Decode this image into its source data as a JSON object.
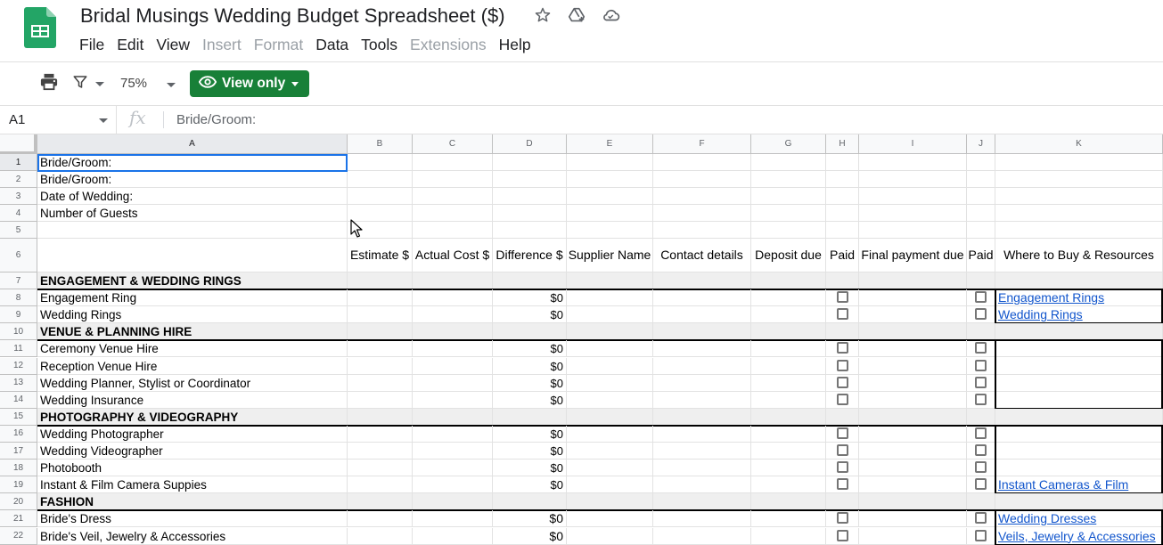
{
  "app": {
    "title": "Bridal Musings Wedding Budget Spreadsheet ($)",
    "title_icons": [
      "star-icon",
      "move-to-drive-icon",
      "cloud-saved-icon"
    ],
    "brand_color": "#188038"
  },
  "menu": [
    {
      "label": "File",
      "disabled": false
    },
    {
      "label": "Edit",
      "disabled": false
    },
    {
      "label": "View",
      "disabled": false
    },
    {
      "label": "Insert",
      "disabled": true
    },
    {
      "label": "Format",
      "disabled": true
    },
    {
      "label": "Data",
      "disabled": false
    },
    {
      "label": "Tools",
      "disabled": false
    },
    {
      "label": "Extensions",
      "disabled": true
    },
    {
      "label": "Help",
      "disabled": false
    }
  ],
  "toolbar": {
    "zoom": "75%",
    "view_only_label": "View only"
  },
  "formula_bar": {
    "cell_ref": "A1",
    "fx_label": "fx",
    "value": "Bride/Groom:"
  },
  "columns": [
    "A",
    "B",
    "C",
    "D",
    "E",
    "F",
    "G",
    "H",
    "I",
    "J",
    "K"
  ],
  "selected_cell": "A1",
  "info_rows": [
    {
      "row": 1,
      "label": "Bride/Groom:"
    },
    {
      "row": 2,
      "label": "Bride/Groom:"
    },
    {
      "row": 3,
      "label": "Date of Wedding:"
    },
    {
      "row": 4,
      "label": "Number of Guests"
    },
    {
      "row": 5,
      "label": ""
    }
  ],
  "header_row": {
    "row": 6,
    "cells": [
      "",
      "Estimate $",
      "Actual Cost $",
      "Difference $",
      "Supplier Name",
      "Contact details",
      "Deposit due",
      "Paid",
      "Final payment due",
      "Paid",
      "Where to Buy & Resources"
    ]
  },
  "sections": [
    {
      "row": 7,
      "title": "ENGAGEMENT & WEDDING RINGS",
      "items": [
        {
          "row": 8,
          "name": "Engagement Ring",
          "difference": "$0",
          "paid_deposit": false,
          "paid_final": false,
          "resource": "Engagement Rings"
        },
        {
          "row": 9,
          "name": "Wedding Rings",
          "difference": "$0",
          "paid_deposit": false,
          "paid_final": false,
          "resource": "Wedding Rings"
        }
      ]
    },
    {
      "row": 10,
      "title": "VENUE & PLANNING HIRE",
      "items": [
        {
          "row": 11,
          "name": "Ceremony Venue Hire",
          "difference": "$0",
          "paid_deposit": false,
          "paid_final": false,
          "resource": ""
        },
        {
          "row": 12,
          "name": "Reception Venue Hire",
          "difference": "$0",
          "paid_deposit": false,
          "paid_final": false,
          "resource": ""
        },
        {
          "row": 13,
          "name": "Wedding Planner, Stylist or Coordinator",
          "difference": "$0",
          "paid_deposit": false,
          "paid_final": false,
          "resource": ""
        },
        {
          "row": 14,
          "name": "Wedding Insurance",
          "difference": "$0",
          "paid_deposit": false,
          "paid_final": false,
          "resource": ""
        }
      ]
    },
    {
      "row": 15,
      "title": "PHOTOGRAPHY & VIDEOGRAPHY",
      "items": [
        {
          "row": 16,
          "name": "Wedding Photographer",
          "difference": "$0",
          "paid_deposit": false,
          "paid_final": false,
          "resource": ""
        },
        {
          "row": 17,
          "name": "Wedding Videographer",
          "difference": "$0",
          "paid_deposit": false,
          "paid_final": false,
          "resource": ""
        },
        {
          "row": 18,
          "name": "Photobooth",
          "difference": "$0",
          "paid_deposit": false,
          "paid_final": false,
          "resource": ""
        },
        {
          "row": 19,
          "name": "Instant & Film Camera Suppies",
          "difference": "$0",
          "paid_deposit": false,
          "paid_final": false,
          "resource": "Instant Cameras & Film"
        }
      ]
    },
    {
      "row": 20,
      "title": "FASHION",
      "items": [
        {
          "row": 21,
          "name": "Bride's Dress",
          "difference": "$0",
          "paid_deposit": false,
          "paid_final": false,
          "resource": "Wedding Dresses"
        },
        {
          "row": 22,
          "name": "Bride's Veil, Jewelry & Accessories",
          "difference": "$0",
          "paid_deposit": false,
          "paid_final": false,
          "resource": "Veils, Jewelry & Accessories"
        }
      ]
    }
  ]
}
